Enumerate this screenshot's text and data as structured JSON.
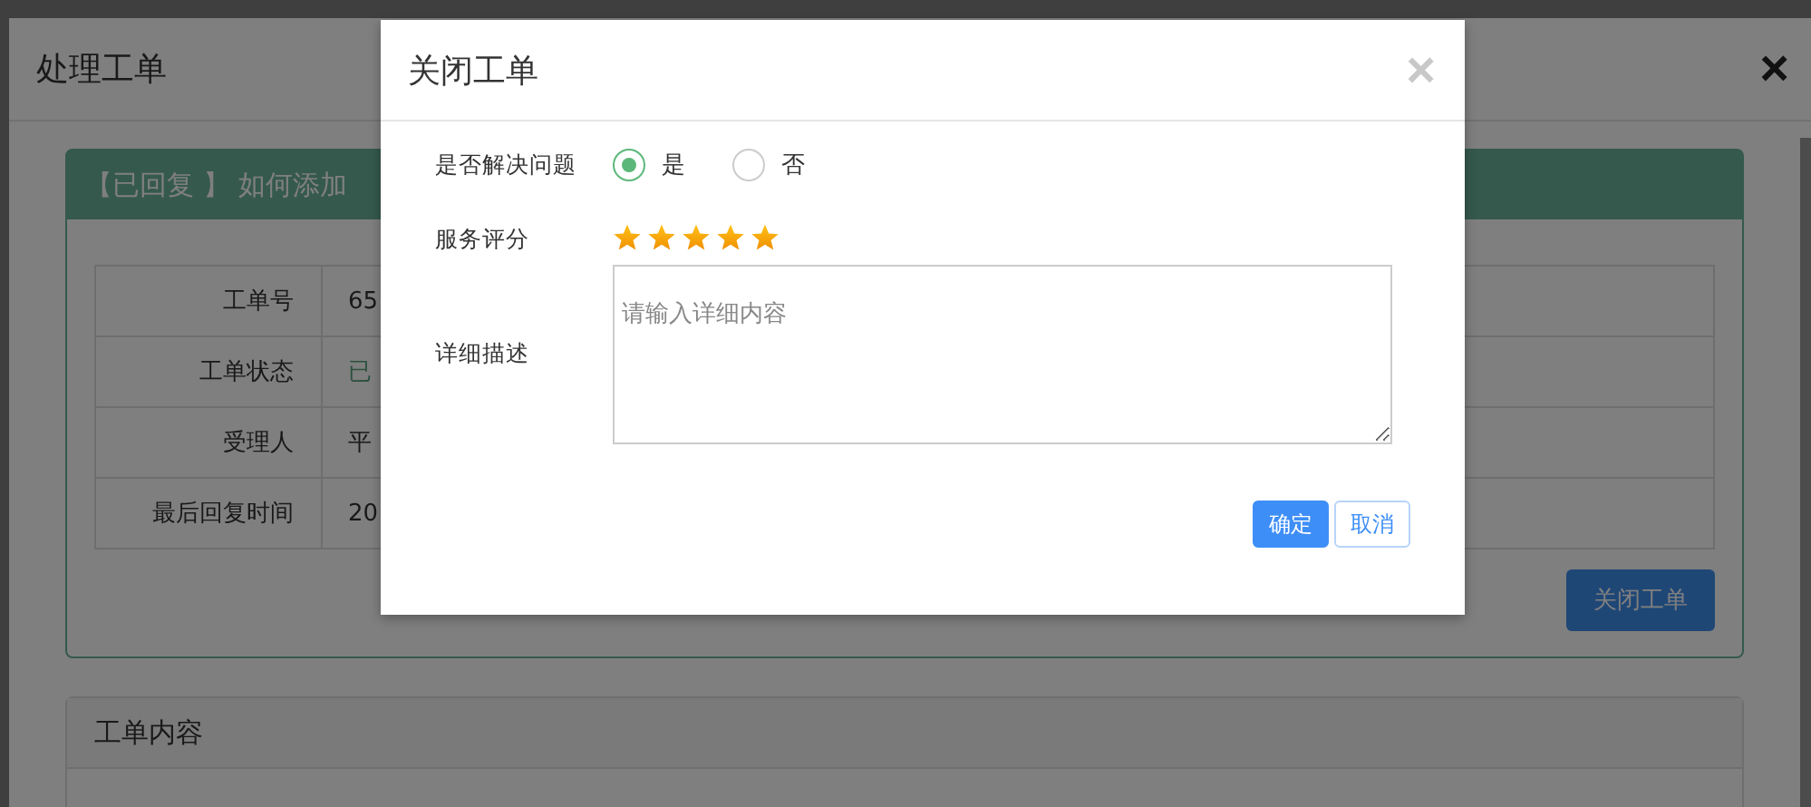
{
  "background_window": {
    "title": "处理工单",
    "close": "×",
    "ticket_card": {
      "header": "【已回复 】 如何添加",
      "details": [
        {
          "label": "工单号",
          "value": "65",
          "kind": "plain"
        },
        {
          "label": "工单状态",
          "value": "已",
          "kind": "status"
        },
        {
          "label": "受理人",
          "value": "平",
          "kind": "plain"
        },
        {
          "label": "最后回复时间",
          "value": "20",
          "kind": "plain"
        }
      ],
      "close_button": "关闭工单"
    },
    "content_card": {
      "header": "工单内容"
    }
  },
  "dialog": {
    "title": "关闭工单",
    "close": "×",
    "resolved": {
      "label": "是否解决问题",
      "options": [
        {
          "label": "是",
          "selected": true
        },
        {
          "label": "否",
          "selected": false
        }
      ]
    },
    "rating": {
      "label": "服务评分",
      "stars": 5
    },
    "description": {
      "label": "详细描述",
      "placeholder": "请输入详细内容"
    },
    "buttons": [
      {
        "label": "确定",
        "kind": "primary"
      },
      {
        "label": "取消",
        "kind": "secondary"
      }
    ]
  }
}
